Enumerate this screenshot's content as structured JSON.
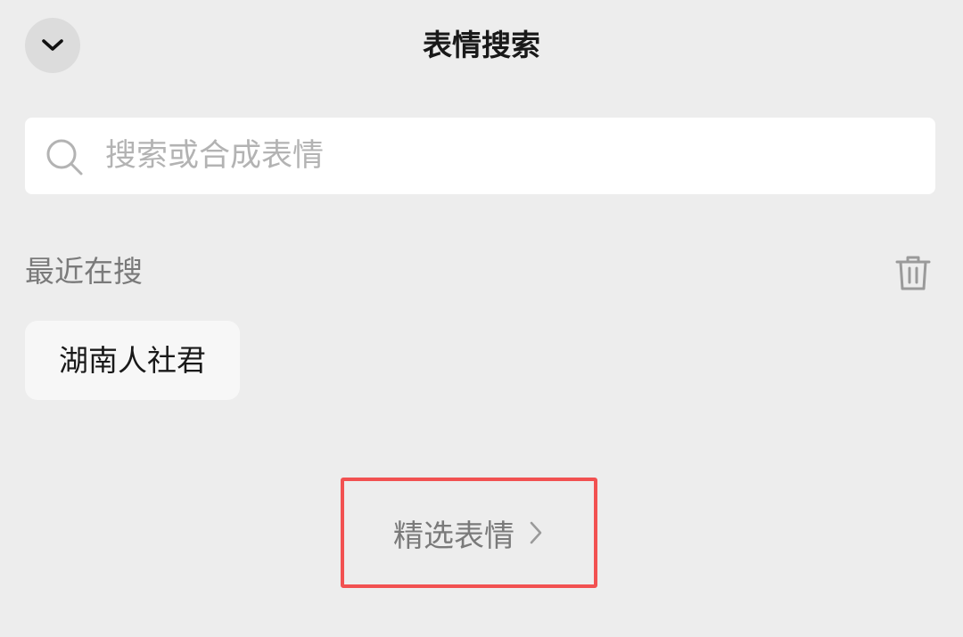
{
  "header": {
    "title": "表情搜索",
    "collapse_icon": "chevron-down-icon"
  },
  "search": {
    "placeholder": "搜索或合成表情",
    "icon": "search-icon"
  },
  "recent": {
    "label": "最近在搜",
    "clear_icon": "trash-icon",
    "items": [
      {
        "label": "湖南人社君"
      }
    ]
  },
  "featured": {
    "label": "精选表情",
    "icon": "chevron-right-icon",
    "highlight_color": "#f25151"
  }
}
